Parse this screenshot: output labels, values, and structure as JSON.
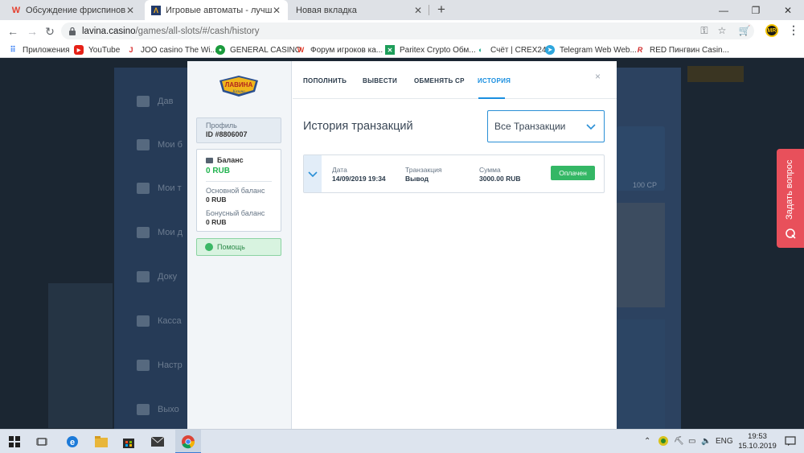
{
  "tabs": [
    {
      "title": "Обсуждение фриспинов, акций",
      "icon": "W"
    },
    {
      "title": "Игровые автоматы - лучшая ко",
      "icon": "Λ"
    },
    {
      "title": "Новая вкладка",
      "icon": ""
    }
  ],
  "address": {
    "host": "lavina.casino",
    "path": "/games/all-slots/#/cash/history"
  },
  "profile_initials": "MR",
  "bookmarks": [
    {
      "label": "Приложения"
    },
    {
      "label": "YouTube"
    },
    {
      "label": "JOO casino The Wi..."
    },
    {
      "label": "GENERAL CASINO"
    },
    {
      "label": "Форум игроков ка..."
    },
    {
      "label": "Paritex Crypto Обм..."
    },
    {
      "label": "Счёт | CREX24"
    },
    {
      "label": "Telegram Web Web..."
    },
    {
      "label": "RED Пингвин Casin..."
    }
  ],
  "bg_menu": [
    "Дав",
    "Мои б",
    "Мои т",
    "Мои д",
    "Доку",
    "Касса",
    "Настр",
    "Выхо"
  ],
  "bg_right_text": "100 CP",
  "modal": {
    "logo_text": "ЛАВИНА",
    "logo_sub": "Казино",
    "profile_label": "Профиль",
    "profile_id": "ID #8806007",
    "balance_label": "Баланс",
    "balance_value": "0 RUB",
    "main_balance_label": "Основной баланс",
    "main_balance_value": "0 RUB",
    "bonus_balance_label": "Бонусный баланс",
    "bonus_balance_value": "0 RUB",
    "help_label": "Помощь",
    "tabs": [
      "ПОПОЛНИТЬ",
      "ВЫВЕСТИ",
      "ОБМЕНЯТЬ CP",
      "ИСТОРИЯ"
    ],
    "close": "×",
    "history_title": "История транзакций",
    "filter_value": "Все Транзакции",
    "transaction": {
      "date_label": "Дата",
      "date_value": "14/09/2019 19:34",
      "type_label": "Транзакция",
      "type_value": "Вывод",
      "sum_label": "Сумма",
      "sum_value": "3000.00 RUB",
      "status": "Оплачен"
    }
  },
  "ask_question": "Задать вопрос",
  "taskbar": {
    "lang": "ENG",
    "time": "19:53",
    "date": "15.10.2019"
  },
  "colors": {
    "accent": "#1a8fe0",
    "success": "#34b765",
    "ask": "#e8505b"
  }
}
